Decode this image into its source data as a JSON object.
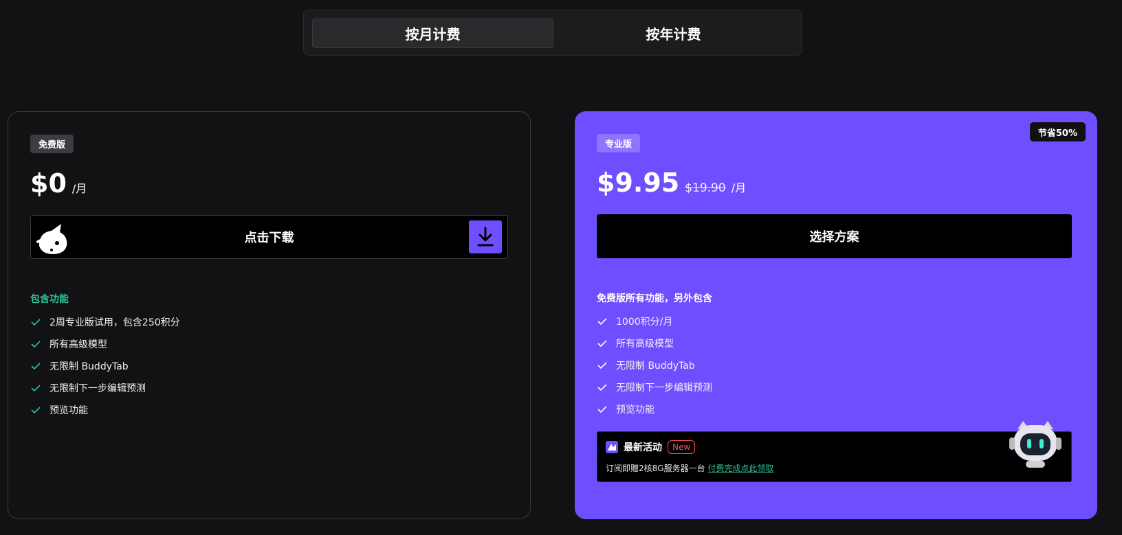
{
  "billing_toggle": {
    "monthly": "按月计费",
    "yearly": "按年计费"
  },
  "free_plan": {
    "badge": "免费版",
    "price": "$0",
    "per": "/月",
    "cta": "点击下载",
    "features_title": "包含功能",
    "features": [
      "2周专业版试用，包含250积分",
      "所有高级模型",
      "无限制 BuddyTab",
      "无限制下一步编辑预测",
      "预览功能"
    ]
  },
  "pro_plan": {
    "badge": "专业版",
    "save_badge": "节省50%",
    "price": "$9.95",
    "old_price": "$19.90",
    "per": "/月",
    "cta": "选择方案",
    "features_title": "免费版所有功能，另外包含",
    "features": [
      "1000积分/月",
      "所有高级模型",
      "无限制 BuddyTab",
      "无限制下一步编辑预测",
      "预览功能"
    ],
    "promo": {
      "title": "最新活动",
      "new_badge": "New",
      "text": "订阅即赠2核8G服务器一台",
      "link": "付费完成点此领取"
    }
  },
  "colors": {
    "accent": "#6e4efe",
    "check_green": "#2fc39c",
    "background": "#121214"
  }
}
